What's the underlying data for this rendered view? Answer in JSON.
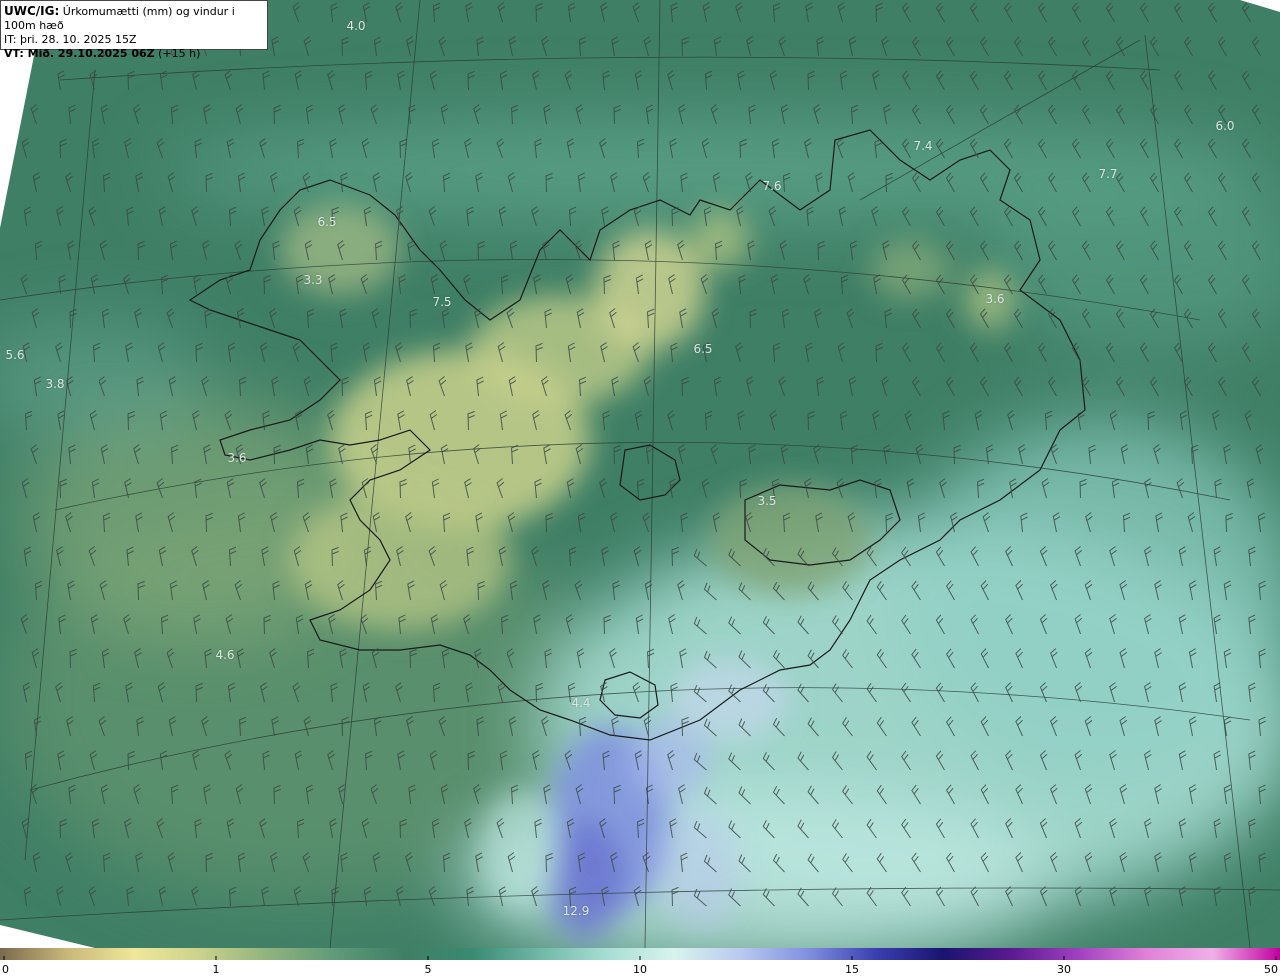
{
  "header": {
    "model_code": "UWC/IG:",
    "title": "Úrkomumætti (mm) og vindur i 100m hæð",
    "initial_time": "IT: þri. 28. 10. 2025 15Z",
    "valid_time_label": "VT: Mið. 29.10.2025 06Z",
    "lead_time": "(+15 h)"
  },
  "labels": [
    {
      "id": "v1",
      "text": "4.0"
    },
    {
      "id": "v2",
      "text": "7.4"
    },
    {
      "id": "v3",
      "text": "6.0"
    },
    {
      "id": "v4",
      "text": "7.6"
    },
    {
      "id": "v5",
      "text": "7.7"
    },
    {
      "id": "v6",
      "text": "6.5"
    },
    {
      "id": "v7",
      "text": "3.3"
    },
    {
      "id": "v8",
      "text": "7.5"
    },
    {
      "id": "v9",
      "text": "3.6"
    },
    {
      "id": "v10",
      "text": "5.6"
    },
    {
      "id": "v11",
      "text": "3.8"
    },
    {
      "id": "v12",
      "text": "6.5"
    },
    {
      "id": "v13",
      "text": "3.6"
    },
    {
      "id": "v14",
      "text": "3.5"
    },
    {
      "id": "v15",
      "text": "4.6"
    },
    {
      "id": "v16",
      "text": "4.4"
    },
    {
      "id": "v17",
      "text": "12.9"
    }
  ],
  "colorbar": {
    "ticks": [
      {
        "text": "0",
        "value": 0
      },
      {
        "text": "1",
        "value": 1
      },
      {
        "text": "5",
        "value": 5
      },
      {
        "text": "10",
        "value": 10
      },
      {
        "text": "15",
        "value": 15
      },
      {
        "text": "30",
        "value": 30
      },
      {
        "text": "50",
        "value": 50
      }
    ],
    "colors": [
      "#7a6a4e",
      "#c9b878",
      "#efe79a",
      "#c9d18c",
      "#8fb27e",
      "#5e9a78",
      "#3f7f66",
      "#3a8a72",
      "#6fb7a6",
      "#a7ddd3",
      "#d9f3ee",
      "#b9c9f0",
      "#7f8fe0",
      "#3a3fb0",
      "#1a1470",
      "#5a1a90",
      "#a040c0",
      "#e080d8",
      "#f0b0e8",
      "#c000a0"
    ]
  },
  "colors": {
    "sea_base": "#3f7f66",
    "land_low": "#5e9a78",
    "dry": "#c9d18c",
    "wet": "#a7ddd3",
    "very_wet": "#7f8fe0",
    "coastline": "#1a1a1a",
    "gridline": "#2a3a34",
    "barb": "#3b4a44"
  }
}
